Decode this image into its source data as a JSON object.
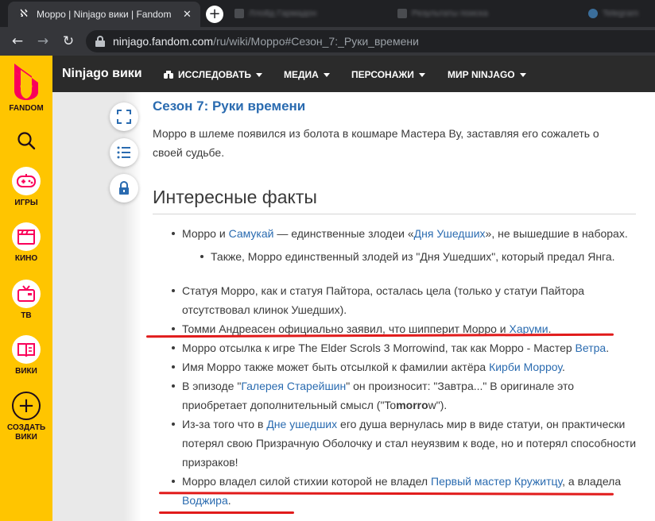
{
  "browser": {
    "tab_title": "Моррo | Ninjago вики | Fandom",
    "tab_close": "✕",
    "new_tab": "+",
    "ghost_tabs": [
      "Ллойд Гармадон",
      "Результаты поиска",
      "Telegram"
    ],
    "url_host": "ninjago.fandom.com",
    "url_path": "/ru/wiki/Морро#Сезон_7:_Руки_времени",
    "back": "←",
    "forward": "→",
    "reload": "↻"
  },
  "rail": {
    "brand": "FANDOM",
    "items": [
      "ИГРЫ",
      "КИНО",
      "ТВ",
      "ВИКИ"
    ],
    "create": "СОЗДАТЬ ВИКИ",
    "create_glyph": "+"
  },
  "wiki_header": {
    "name": "Ninjago вики",
    "menu": [
      "ИССЛЕДОВАТЬ",
      "МЕДИА",
      "ПЕРСОНАЖИ",
      "МИР NINJAGO"
    ]
  },
  "article": {
    "season_heading": "Сезон 7: Руки времени",
    "intro": "Морро в шлеме появился из болота в кошмаре Мастера Ву, заставляя его сожалеть о своей судьбе.",
    "facts_heading": "Интересные факты",
    "fact1": {
      "a": "Морро и ",
      "link1": "Самукай",
      "b": " — единственные злодеи «",
      "link2": "Дня Ушедших",
      "c": "», не вышедшие в наборах."
    },
    "fact1_sub": "Также, Морро единственный злодей из \"Дня Ушедших\", который предал Янга.",
    "fact2": "Статуя Морро, как и статуя Пайтора, осталась цела (только у статуи Пайтора отсутствовал клинок Ушедших).",
    "fact3": {
      "a": "Томми Андреасен официально заявил, что шипперит Морро и ",
      "link": "Харуми",
      "b": "."
    },
    "fact4": {
      "a": "Морро отсылка к игре The Elder Scrols 3 Morrowind, так как Морро - Мастер ",
      "link": "Ветра",
      "b": "."
    },
    "fact5": {
      "a": "Имя Морро также может быть отсылкой к фамилии актёра ",
      "link": "Кирби Морроу",
      "b": "."
    },
    "fact6": {
      "a": "В эпизоде \"",
      "link": "Галерея Старейшин",
      "b": "\" он произносит: \"Завтра...\" В оригинале это приобретает дополнительный смысл (\"To",
      "bold": "morro",
      "c": "w\")."
    },
    "fact7": {
      "a": "Из-за того что в ",
      "link": "Дне ушедших",
      "b": " его душа вернулась мир в виде статуи, он практически потерял свою Призрачную Оболочку и стал неуязвим к воде, но и потерял способности призраков!"
    },
    "fact8": {
      "a": "Морро владел силой стихии которой не владел ",
      "link1": "Первый мастер Кружитцу",
      "b": ", а владела ",
      "link2": "Воджира",
      "c": "."
    }
  },
  "colors": {
    "rail": "#ffc500",
    "wiki_header": "#2b2b2b",
    "link": "#2a6bb0",
    "annotation": "#e11b1b"
  }
}
